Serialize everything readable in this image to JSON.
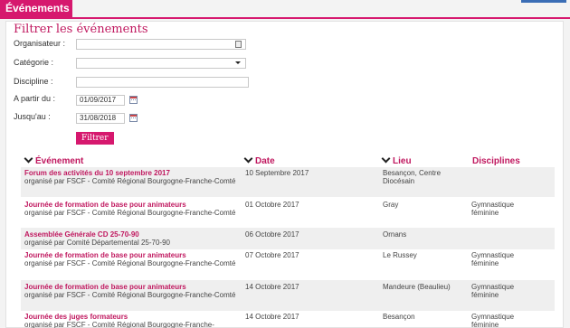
{
  "header": {
    "tab_label": "Événements"
  },
  "filter": {
    "title": "Filtrer les événements",
    "organisateur_label": "Organisateur :",
    "organisateur_value": "",
    "categorie_label": "Catégorie :",
    "categorie_value": "",
    "discipline_label": "Discipline :",
    "discipline_value": "",
    "from_label": "A partir du :",
    "from_value": "01/09/2017",
    "to_label": "Jusqu'au :",
    "to_value": "31/08/2018",
    "submit_label": "Filtrer"
  },
  "table": {
    "columns": [
      "Événement",
      "Date",
      "Lieu",
      "Disciplines"
    ],
    "rows": [
      {
        "title": "Forum des activités du 10 septembre 2017",
        "organizer": "organisé par FSCF - Comité Régional Bourgogne-Franche-Comté",
        "date": "10 Septembre 2017",
        "place": "Besançon, Centre Diocésain",
        "discipline": ""
      },
      {
        "title": "Journée de formation de base pour animateurs",
        "organizer": "organisé par FSCF - Comité Régional Bourgogne-Franche-Comté",
        "date": "01 Octobre 2017",
        "place": "Gray",
        "discipline": "Gymnastique féminine"
      },
      {
        "title": "Assemblée Générale CD 25-70-90",
        "organizer": "organisé par Comité Départemental 25-70-90",
        "date": "06 Octobre 2017",
        "place": "Ornans",
        "discipline": ""
      },
      {
        "title": "Journée de formation de base pour animateurs",
        "organizer": "organisé par FSCF - Comité Régional Bourgogne-Franche-Comté",
        "date": "07 Octobre 2017",
        "place": "Le Russey",
        "discipline": "Gymnastique féminine"
      },
      {
        "title": "Journée de formation de base pour animateurs",
        "organizer": "organisé par FSCF - Comité Régional Bourgogne-Franche-Comté",
        "date": "14 Octobre 2017",
        "place": "Mandeure (Beaulieu)",
        "discipline": "Gymnastique féminine"
      },
      {
        "title": "Journée des juges formateurs",
        "organizer": "organisé par FSCF - Comité Régional Bourgogne-Franche-",
        "date": "14 Octobre 2017",
        "place": "Besançon",
        "discipline": "Gymnastique féminine"
      }
    ]
  },
  "icons": {
    "calendar": "calendar-icon",
    "lookup": "lookup-icon",
    "select": "chevron-down-icon",
    "sort": "chevron-down-icon"
  },
  "colors": {
    "accent": "#d6186e",
    "row_shade": "#efefef"
  }
}
